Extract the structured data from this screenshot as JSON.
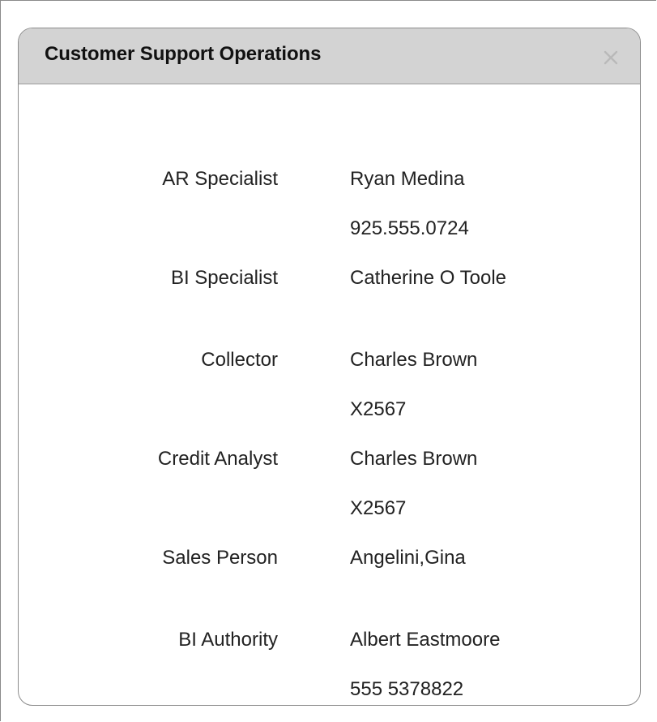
{
  "dialog": {
    "title": "Customer Support Operations",
    "close_icon": "close-icon"
  },
  "contacts": [
    {
      "label": "AR Specialist",
      "value": "Ryan Medina"
    },
    {
      "label": "",
      "value": "925.555.0724"
    },
    {
      "label": "BI Specialist",
      "value": "Catherine O Toole"
    },
    {
      "label": "Collector",
      "value": "Charles Brown"
    },
    {
      "label": "",
      "value": "X2567"
    },
    {
      "label": "Credit Analyst",
      "value": "Charles Brown"
    },
    {
      "label": "",
      "value": "X2567"
    },
    {
      "label": "Sales Person",
      "value": "Angelini,Gina"
    },
    {
      "label": "BI Authority",
      "value": "Albert Eastmoore"
    },
    {
      "label": "",
      "value": "555 5378822"
    }
  ]
}
